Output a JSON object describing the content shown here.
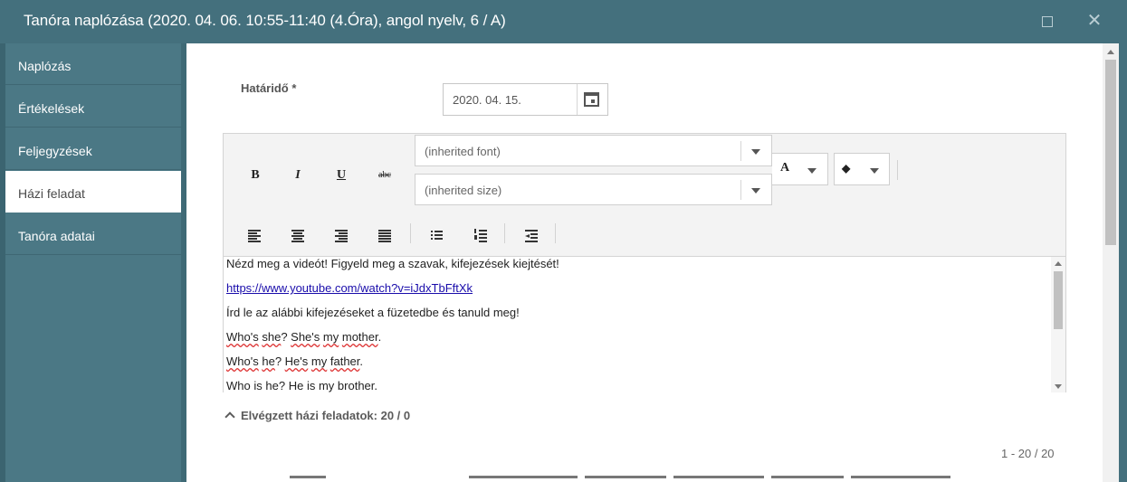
{
  "window": {
    "title": "Tanóra naplózása (2020. 04. 06. 10:55-11:40 (4.Óra), angol nyelv, 6 / A)",
    "maximize_icon": "maximize-icon",
    "close_icon": "close-icon",
    "close_glyph": "✕"
  },
  "sidebar": {
    "items": [
      {
        "label": "Naplózás",
        "active": false
      },
      {
        "label": "Értékelések",
        "active": false
      },
      {
        "label": "Feljegyzések",
        "active": false
      },
      {
        "label": "Házi feladat",
        "active": true
      },
      {
        "label": "Tanóra adatai",
        "active": false
      }
    ]
  },
  "form": {
    "deadline_label": "Határidő *",
    "deadline_value": "2020. 04. 15.",
    "calendar_icon": "calendar-icon"
  },
  "toolbar": {
    "bold": "B",
    "italic": "I",
    "underline": "U",
    "strike": "abc",
    "font_select": "(inherited font)",
    "size_select": "(inherited size)",
    "font_color_glyph": "A",
    "highlight_glyph": "◆"
  },
  "editor": {
    "lines": [
      "Nézd meg a videót! Figyeld meg a szavak, kifejezések kiejtését!",
      "https://www.youtube.com/watch?v=iJdxTbFftXk",
      "Írd le az alábbi kifejezéseket a füzetedbe és tanuld meg!",
      "Who's she? She's my mother.",
      "Who's he? He's my father.",
      "Who is he? He is my brother."
    ],
    "line4": {
      "w1": "Who's",
      "w2": "she",
      "w3": "She's",
      "w4": "my",
      "w5": "mother"
    },
    "line5": {
      "w1": "Who's",
      "w2": "he",
      "w3": "He's",
      "w4": "my",
      "w5": "father"
    },
    "line6": {
      "w1": "Who",
      "w2": "is",
      "w3": "he",
      "w4": "He",
      "w5": "is",
      "w6": "my",
      "w7": "brother"
    }
  },
  "homework": {
    "completed_label": "Elvégzett házi feladatok: 20 / 0",
    "pager": "1 - 20 / 20"
  },
  "colors": {
    "titlebar": "#44707d",
    "sidebar": "#4b7885",
    "link": "#1a0dab"
  }
}
